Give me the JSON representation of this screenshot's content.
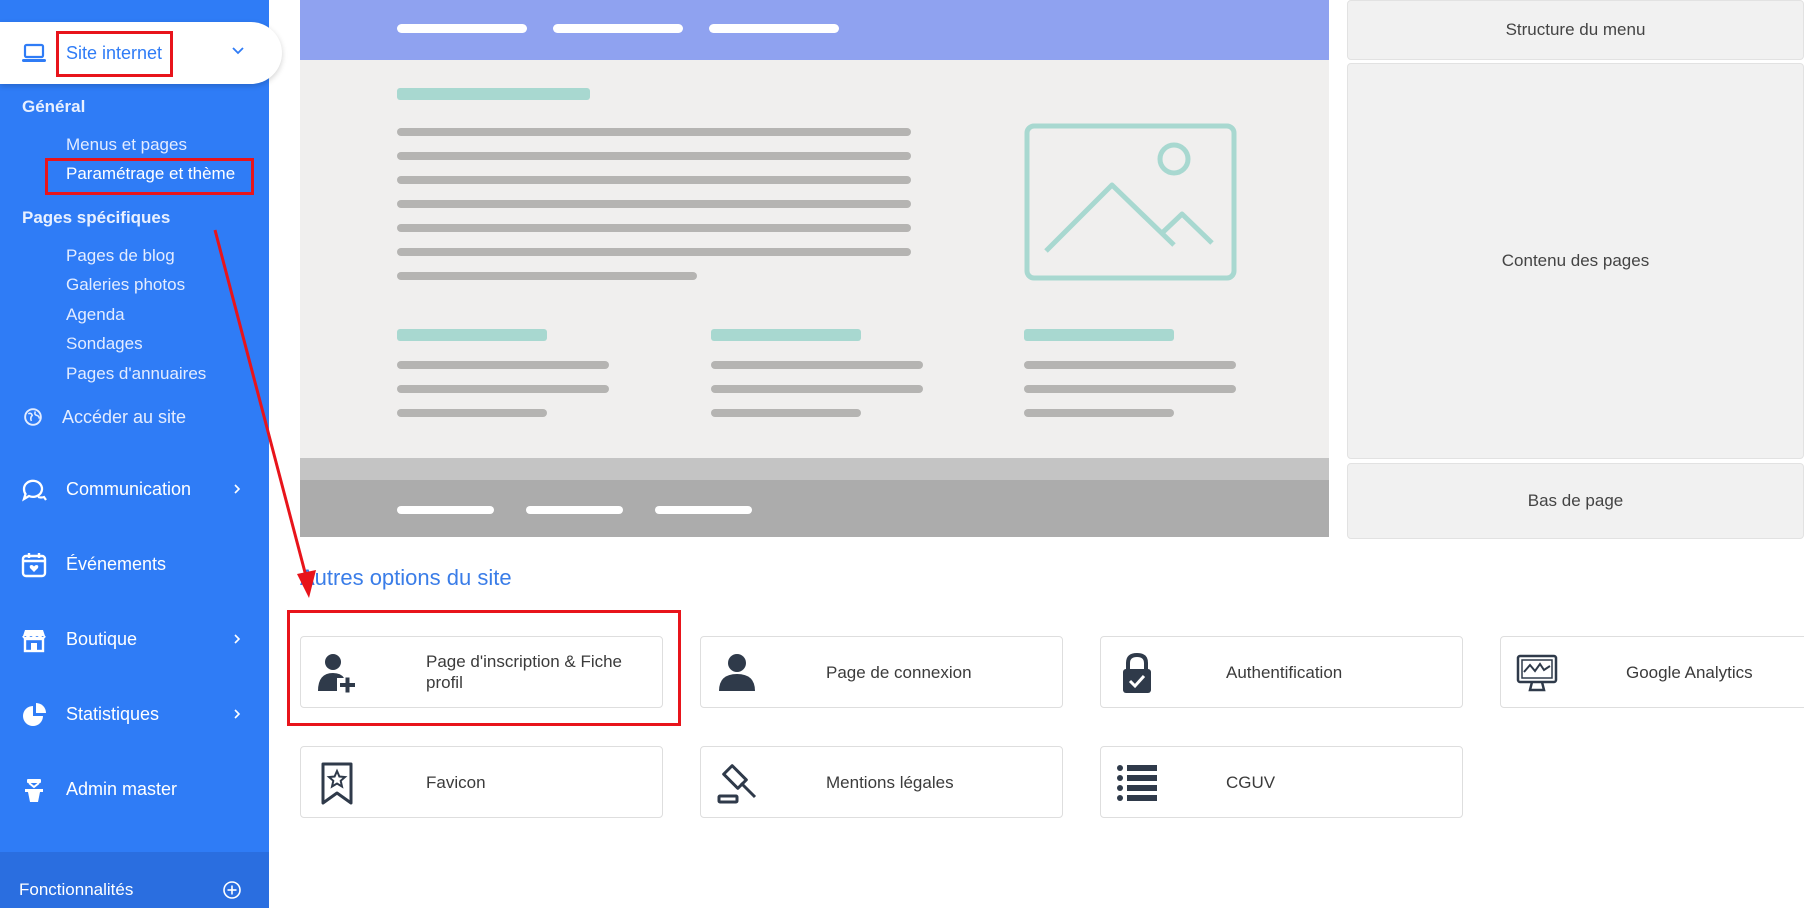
{
  "sidebar": {
    "site_internet": "Site internet",
    "general_title": "Général",
    "general_items": [
      "Menus et pages",
      "Paramétrage et thème"
    ],
    "specific_title": "Pages spécifiques",
    "specific_items": [
      "Pages de blog",
      "Galeries photos",
      "Agenda",
      "Sondages",
      "Pages d'annuaires"
    ],
    "access_site": "Accéder au site",
    "menu": [
      "Communication",
      "Événements",
      "Boutique",
      "Statistiques",
      "Admin master"
    ],
    "fonctionnalites": "Fonctionnalités"
  },
  "sections": {
    "menu_structure": "Structure du menu",
    "page_content": "Contenu des pages",
    "page_footer": "Bas de page"
  },
  "options": {
    "title": "Autres options du site",
    "cards": [
      {
        "label": "Page d'inscription & Fiche profil",
        "icon": "user-plus-icon"
      },
      {
        "label": "Page de connexion",
        "icon": "user-icon"
      },
      {
        "label": "Authentification",
        "icon": "lock-check-icon"
      },
      {
        "label": "Google Analytics",
        "icon": "monitor-chart-icon"
      },
      {
        "label": "Favicon",
        "icon": "bookmark-star-icon"
      },
      {
        "label": "Mentions légales",
        "icon": "gavel-icon"
      },
      {
        "label": "CGUV",
        "icon": "list-icon"
      }
    ]
  },
  "colors": {
    "sidebar": "#2f7cf6",
    "accent": "#3a7de8",
    "annotation": "#e8141b",
    "preview_header": "#8fa2f0",
    "preview_teal": "#a8d8d0"
  }
}
